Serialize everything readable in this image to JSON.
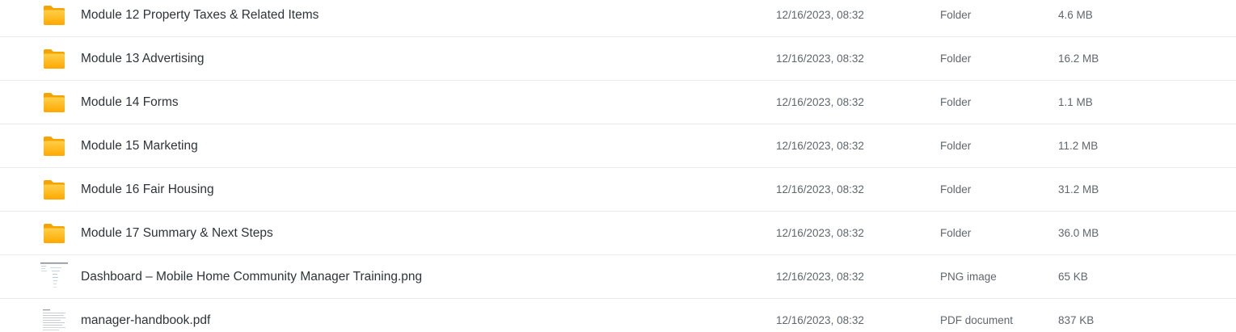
{
  "files": [
    {
      "name": "Module 12 Property Taxes & Related Items",
      "date": "12/16/2023, 08:32",
      "kind": "Folder",
      "size": "4.6 MB",
      "icon": "folder-icon"
    },
    {
      "name": "Module 13 Advertising",
      "date": "12/16/2023, 08:32",
      "kind": "Folder",
      "size": "16.2 MB",
      "icon": "folder-icon"
    },
    {
      "name": "Module 14 Forms",
      "date": "12/16/2023, 08:32",
      "kind": "Folder",
      "size": "1.1 MB",
      "icon": "folder-icon"
    },
    {
      "name": "Module 15 Marketing",
      "date": "12/16/2023, 08:32",
      "kind": "Folder",
      "size": "11.2 MB",
      "icon": "folder-icon"
    },
    {
      "name": "Module 16 Fair Housing",
      "date": "12/16/2023, 08:32",
      "kind": "Folder",
      "size": "31.2 MB",
      "icon": "folder-icon"
    },
    {
      "name": "Module 17 Summary & Next Steps",
      "date": "12/16/2023, 08:32",
      "kind": "Folder",
      "size": "36.0 MB",
      "icon": "folder-icon"
    },
    {
      "name": "Dashboard – Mobile Home Community Manager Training.png",
      "date": "12/16/2023, 08:32",
      "kind": "PNG image",
      "size": "65 KB",
      "icon": "image-thumbnail-icon"
    },
    {
      "name": "manager-handbook.pdf",
      "date": "12/16/2023, 08:32",
      "kind": "PDF document",
      "size": "837 KB",
      "icon": "pdf-thumbnail-icon"
    }
  ],
  "colors": {
    "folder_top": "#FFC83D",
    "folder_bottom": "#FFA800",
    "row_divider": "#ECECEC"
  }
}
